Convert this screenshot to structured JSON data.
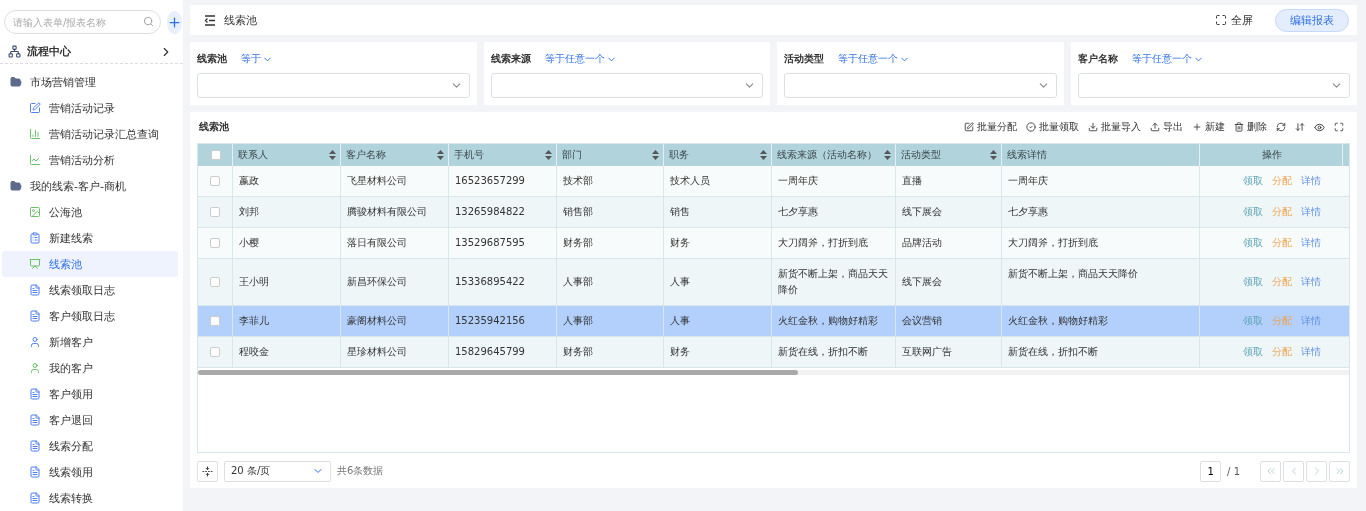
{
  "sidebar": {
    "search": {
      "placeholder": "请输入表单/报表名称"
    },
    "flow_center": "流程中心",
    "groups": [
      {
        "label": "市场营销管理",
        "expanded": true,
        "children": [
          {
            "label": "营销活动记录",
            "kind": "form",
            "selected": false
          },
          {
            "label": "营销活动记录汇总查询",
            "kind": "bar-report",
            "selected": false
          },
          {
            "label": "营销活动分析",
            "kind": "line-report",
            "selected": false
          }
        ]
      },
      {
        "label": "我的线索-客户-商机",
        "expanded": true,
        "children": [
          {
            "label": "公海池",
            "kind": "gallery",
            "selected": false
          },
          {
            "label": "新建线索",
            "kind": "list",
            "selected": false
          },
          {
            "label": "线索池",
            "kind": "screen",
            "selected": true
          },
          {
            "label": "线索领取日志",
            "kind": "doc",
            "selected": false
          },
          {
            "label": "客户领取日志",
            "kind": "doc",
            "selected": false
          },
          {
            "label": "新增客户",
            "kind": "person",
            "selected": false
          },
          {
            "label": "我的客户",
            "kind": "person-green",
            "selected": false
          },
          {
            "label": "客户领用",
            "kind": "doc",
            "selected": false
          },
          {
            "label": "客户退回",
            "kind": "doc",
            "selected": false
          },
          {
            "label": "线索分配",
            "kind": "doc",
            "selected": false
          },
          {
            "label": "线索领用",
            "kind": "doc",
            "selected": false
          },
          {
            "label": "线索转换",
            "kind": "doc",
            "selected": false
          }
        ]
      }
    ]
  },
  "header": {
    "title": "线索池",
    "fullscreen": "全屏",
    "edit_button": "编辑报表"
  },
  "filters": [
    {
      "label": "线索池",
      "operator": "等于"
    },
    {
      "label": "线索来源",
      "operator": "等于任意一个"
    },
    {
      "label": "活动类型",
      "operator": "等于任意一个"
    },
    {
      "label": "客户名称",
      "operator": "等于任意一个"
    }
  ],
  "table": {
    "title": "线索池",
    "toolbar": [
      {
        "label": "批量分配",
        "kind": "edit"
      },
      {
        "label": "批量领取",
        "kind": "check"
      },
      {
        "label": "批量导入",
        "kind": "import"
      },
      {
        "label": "导出",
        "kind": "export"
      },
      {
        "label": "新建",
        "kind": "add"
      },
      {
        "label": "删除",
        "kind": "delete"
      }
    ],
    "columns": [
      {
        "label": "联系人",
        "sortable": true
      },
      {
        "label": "客户名称",
        "sortable": true
      },
      {
        "label": "手机号",
        "sortable": true
      },
      {
        "label": "部门",
        "sortable": true
      },
      {
        "label": "职务",
        "sortable": true
      },
      {
        "label": "线索来源（活动名称）",
        "sortable": true
      },
      {
        "label": "活动类型",
        "sortable": true
      },
      {
        "label": "线索详情",
        "sortable": false
      },
      {
        "label": "操作",
        "sortable": false
      }
    ],
    "all_checked": false,
    "rows": [
      {
        "selected": false,
        "checked": false,
        "cells": [
          "嬴政",
          "飞星材料公司",
          "16523657299",
          "技术部",
          "技术人员",
          "一周年庆",
          "直播",
          "一周年庆"
        ],
        "actions": [
          {
            "label": "领取",
            "kind": "claim"
          },
          {
            "label": "分配",
            "kind": "assign"
          },
          {
            "label": "详情",
            "kind": "detail"
          }
        ]
      },
      {
        "selected": false,
        "checked": false,
        "cells": [
          "刘邦",
          "腾骏材料有限公司",
          "13265984822",
          "销售部",
          "销售",
          "七夕享惠",
          "线下展会",
          "七夕享惠"
        ],
        "actions": [
          {
            "label": "领取",
            "kind": "claim"
          },
          {
            "label": "分配",
            "kind": "assign"
          },
          {
            "label": "详情",
            "kind": "detail"
          }
        ]
      },
      {
        "selected": false,
        "checked": false,
        "cells": [
          "小樱",
          "落日有限公司",
          "13529687595",
          "财务部",
          "财务",
          "大刀阔斧，打折到底",
          "品牌活动",
          "大刀阔斧，打折到底"
        ],
        "actions": [
          {
            "label": "领取",
            "kind": "claim"
          },
          {
            "label": "分配",
            "kind": "assign"
          },
          {
            "label": "详情",
            "kind": "detail"
          }
        ]
      },
      {
        "selected": false,
        "checked": false,
        "cells": [
          "王小明",
          "新昌环保公司",
          "15336895422",
          "人事部",
          "人事",
          "新货不断上架，商品天天降价",
          "线下展会",
          "新货不断上架，商品天天降价"
        ],
        "actions": [
          {
            "label": "领取",
            "kind": "claim"
          },
          {
            "label": "分配",
            "kind": "assign"
          },
          {
            "label": "详情",
            "kind": "detail"
          }
        ]
      },
      {
        "selected": true,
        "checked": false,
        "cells": [
          "李菲儿",
          "豪阁材料公司",
          "15235942156",
          "人事部",
          "人事",
          "火红金秋，购物好精彩",
          "会议营销",
          "火红金秋，购物好精彩"
        ],
        "actions": [
          {
            "label": "领取",
            "kind": "claim"
          },
          {
            "label": "分配",
            "kind": "assign"
          },
          {
            "label": "详情",
            "kind": "detail"
          }
        ]
      },
      {
        "selected": false,
        "checked": false,
        "cells": [
          "程咬金",
          "星珍材料公司",
          "15829645799",
          "财务部",
          "财务",
          "新货在线，折扣不断",
          "互联网广告",
          "新货在线，折扣不断"
        ],
        "actions": [
          {
            "label": "领取",
            "kind": "claim"
          },
          {
            "label": "分配",
            "kind": "assign"
          },
          {
            "label": "详情",
            "kind": "detail"
          }
        ]
      }
    ]
  },
  "pagination": {
    "page_size": "20 条/页",
    "total": "共6条数据",
    "page": "1",
    "pages": "/ 1"
  }
}
